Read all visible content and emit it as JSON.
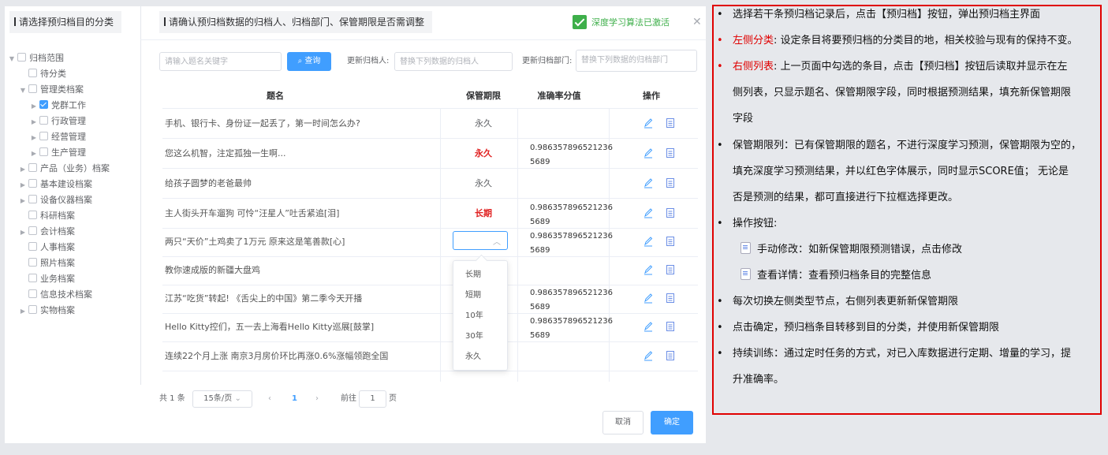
{
  "left_panel": {
    "title": "请选择预归档目的分类",
    "tree": [
      {
        "label": "归档范围",
        "checked": false
      },
      {
        "label": "待分类",
        "checked": false
      },
      {
        "label": "管理类档案",
        "checked": false
      },
      {
        "label": "党群工作",
        "checked": true
      },
      {
        "label": "行政管理",
        "checked": false
      },
      {
        "label": "经营管理",
        "checked": false
      },
      {
        "label": "生产管理",
        "checked": false
      },
      {
        "label": "产品（业务）档案",
        "checked": false
      },
      {
        "label": "基本建设档案",
        "checked": false
      },
      {
        "label": "设备仪器档案",
        "checked": false
      },
      {
        "label": "科研档案",
        "checked": false
      },
      {
        "label": "会计档案",
        "checked": false
      },
      {
        "label": "人事档案",
        "checked": false
      },
      {
        "label": "照片档案",
        "checked": false
      },
      {
        "label": "业务档案",
        "checked": false
      },
      {
        "label": "信息技术档案",
        "checked": false
      },
      {
        "label": "实物档案",
        "checked": false
      }
    ]
  },
  "main": {
    "title": "请确认预归档数据的归档人、归档部门、保管期限是否需调整",
    "algo_status": "深度学习算法已激活",
    "search_placeholder": "请输入题名关键字",
    "query_label": "查询",
    "update_person_label": "更新归档人:",
    "update_person_placeholder": "替换下列数据的归档人",
    "update_dept_label": "更新归档部门:",
    "update_dept_placeholder": "替换下列数据的归档部门",
    "columns": [
      "题名",
      "保管期限",
      "准确率分值",
      "操作"
    ],
    "rows": [
      {
        "title": "手机、银行卡、身份证一起丢了，第一时间怎么办?",
        "period": "永久",
        "score": "",
        "period_red": false
      },
      {
        "title": "您这么机智，注定孤独一生啊...",
        "period": "永久",
        "score": "0.9863578965212365689",
        "period_red": true
      },
      {
        "title": "给孩子圆梦的老爸最帅",
        "period": "永久",
        "score": "",
        "period_red": false
      },
      {
        "title": "主人街头开车遛狗 可怜“汪星人”吐舌紧追[泪]",
        "period": "长期",
        "score": "0.9863578965212365689",
        "period_red": true
      },
      {
        "title": "两只“天价”土鸡卖了1万元 原来这是笔善款[心]",
        "period": "",
        "score": "0.9863578965212365689",
        "period_red": false
      },
      {
        "title": "教你速成版的新疆大盘鸡",
        "period": "",
        "score": "",
        "period_red": false
      },
      {
        "title": "江苏“吃货”转起! 《舌尖上的中国》第二季今天开播",
        "period": "",
        "score": "0.9863578965212365689",
        "period_red": false
      },
      {
        "title": "Hello Kitty控们，五一去上海看Hello Kitty巡展[鼓掌]",
        "period": "",
        "score": "0.9863578965212365689",
        "period_red": false
      },
      {
        "title": "连续22个月上涨 南京3月房价环比再涨0.6%涨幅领跑全国",
        "period": "",
        "score": "",
        "period_red": false
      }
    ],
    "dropdown_options": [
      "长期",
      "短期",
      "10年",
      "30年",
      "永久"
    ],
    "pagination": {
      "total": "共 1 条",
      "page_size": "15条/页",
      "current_page": "1",
      "goto_label": "前往",
      "goto_value": "1",
      "page_unit": "页"
    },
    "cancel_label": "取消",
    "confirm_label": "确定"
  },
  "notes": {
    "n1": "选择若干条预归档记录后，点击【预归档】按钮，弹出预归档主界面",
    "n2_head": "左侧分类",
    "n2_body": ": 设定条目将要预归档的分类目的地，相关校验与现有的保持不变。",
    "n3_head": "右侧列表",
    "n3_line1": ": 上一页面中勾选的条目，点击【预归档】按钮后读取并显示在左",
    "n3_line2": "侧列表，只显示题名、保管期限字段，同时根据预测结果，填充新保管期限",
    "n3_line3": "字段",
    "n4_line1": "保管期限列：已有保管期限的题名，不进行深度学习预测，保管期限为空的，",
    "n4_line2": "填充深度学习预测结果，并以红色字体展示，同时显示SCORE值；  无论是",
    "n4_line3": "否是预测的结果，都可直接进行下拉框选择更改。",
    "n5": "操作按钮:",
    "n5_a": "手动修改：如新保管期限预测错误，点击修改",
    "n5_b": "查看详情：查看预归档条目的完整信息",
    "n6": "每次切换左侧类型节点，右侧列表更新新保管期限",
    "n7": "点击确定，预归档条目转移到目的分类，并使用新保管期限",
    "n8_line1": "持续训练：通过定时任务的方式，对已入库数据进行定期、增量的学习，提",
    "n8_line2": "升准确率。"
  }
}
